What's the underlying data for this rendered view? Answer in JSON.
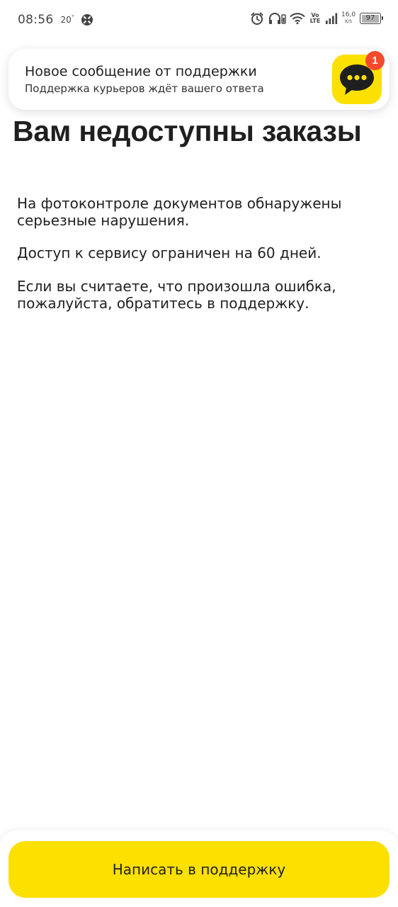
{
  "status_bar": {
    "time": "08:56",
    "temperature": "20",
    "temperature_unit": "°",
    "network_type_top": "Vo",
    "network_type_bottom": "LTE",
    "speed_value": "16,0",
    "speed_unit": "K/S",
    "battery_level": "97",
    "icons": [
      "app-notification-icon",
      "alarm-icon",
      "headphones-icon",
      "wifi-icon",
      "signal-icon",
      "battery-icon"
    ]
  },
  "notification": {
    "title": "Новое сообщение от поддержки",
    "subtitle": "Поддержка курьеров ждёт вашего ответа",
    "icon": "chat-bubble-icon",
    "badge_count": "1",
    "accent_color": "#fce000",
    "badge_color": "#f5492e"
  },
  "main": {
    "title": "Вам недоступны заказы",
    "paragraphs": [
      "На фотоконтроле документов обнаружены серьезные нарушения.",
      "Доступ к сервису ограничен на 60 дней.",
      "Если вы считаете, что произошла ошибка, пожалуйста, обратитесь в поддержку."
    ]
  },
  "footer": {
    "button_label": "Написать в поддержку",
    "button_color": "#fce000"
  }
}
